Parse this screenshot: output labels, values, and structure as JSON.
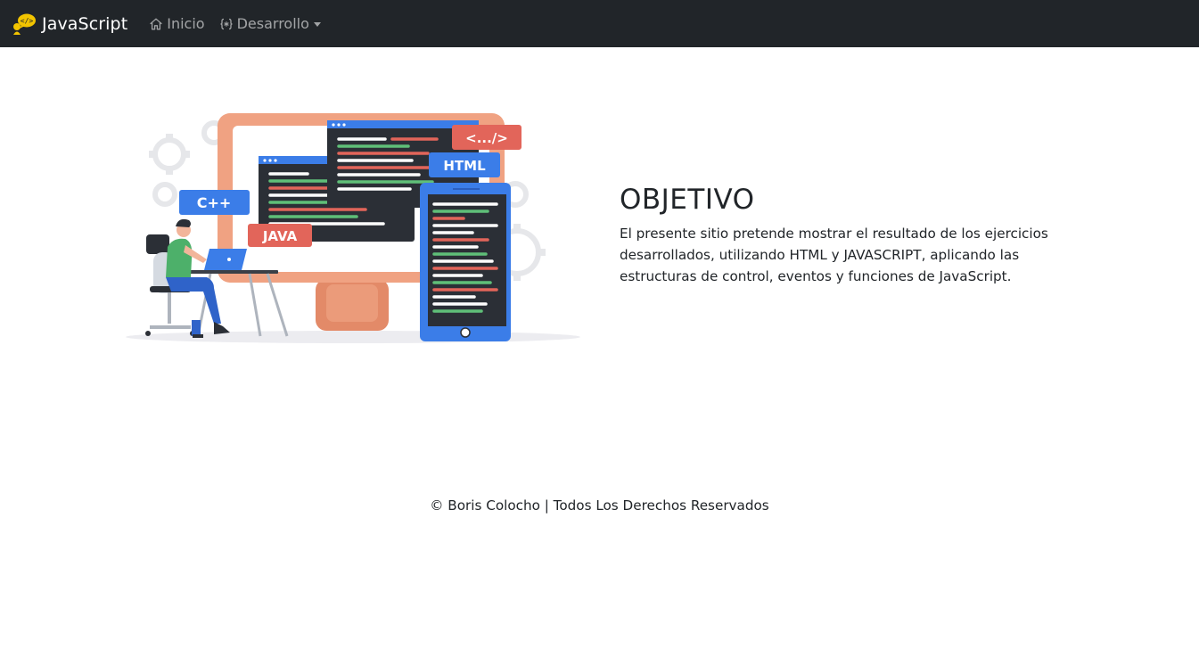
{
  "navbar": {
    "brand": "JavaScript",
    "logo_icon": "javascript-speech-bubble-logo-icon",
    "items": [
      {
        "label": "Inicio",
        "icon": "house-icon"
      },
      {
        "label": "Desarrollo",
        "icon": "code-braces-icon",
        "has_dropdown": true
      }
    ],
    "colors": {
      "background": "#212529",
      "brand_text": "#ffffff",
      "link_text": "rgba(255,255,255,0.58)",
      "logo": "#f2c400"
    }
  },
  "hero": {
    "illustration": {
      "icon": "developer-at-desk-illustration",
      "badges": [
        "C++",
        "JAVA",
        "HTML",
        "<.../>"
      ]
    },
    "title": "OBJETIVO",
    "description": "El presente sitio pretende mostrar el resultado de los ejercicios desarrollados, utilizando HTML y JAVASCRIPT, aplicando las estructuras de control, eventos y funciones de JavaScript."
  },
  "footer": {
    "text": "© Boris Colocho | Todos Los Derechos Reservados"
  }
}
